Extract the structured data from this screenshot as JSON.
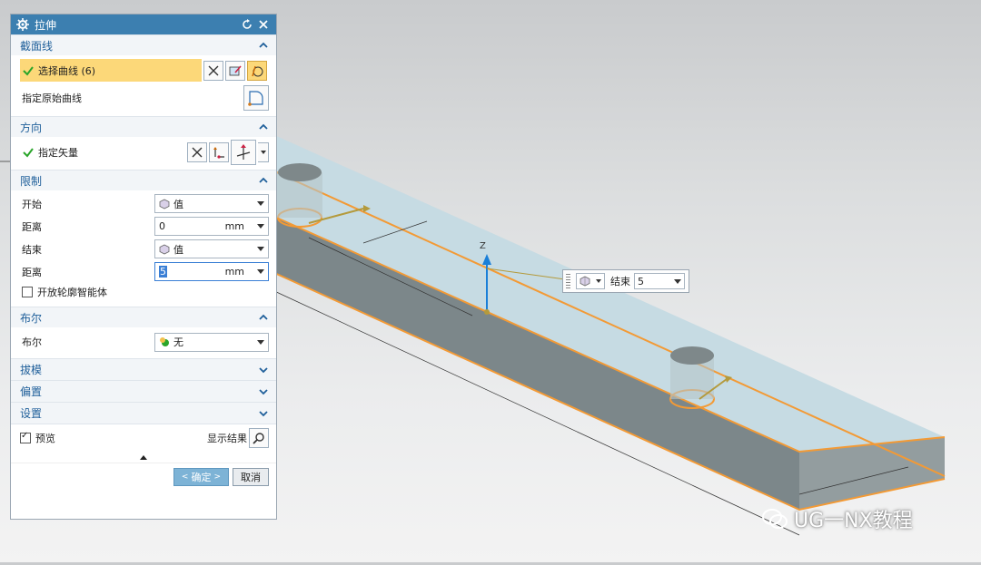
{
  "dialog": {
    "title": "拉伸",
    "section_curve": {
      "title": "截面线",
      "select_curve_label": "选择曲线 (6)",
      "origin_curve_label": "指定原始曲线"
    },
    "section_direction": {
      "title": "方向",
      "vector_label": "指定矢量"
    },
    "section_limits": {
      "title": "限制",
      "start_label": "开始",
      "start_value": "值",
      "distance1_label": "距离",
      "distance1_value": "0",
      "distance1_unit": "mm",
      "end_label": "结束",
      "end_value": "值",
      "distance2_label": "距离",
      "distance2_value": "5",
      "distance2_unit": "mm",
      "open_profile_label": "开放轮廓智能体"
    },
    "section_boolean": {
      "title": "布尔",
      "boolean_label": "布尔",
      "boolean_value": "无"
    },
    "section_draft": {
      "title": "拔模"
    },
    "section_offset": {
      "title": "偏置"
    },
    "section_settings": {
      "title": "设置"
    },
    "preview_label": "预览",
    "show_result_label": "显示结果",
    "ok_label": "确定",
    "cancel_label": "取消"
  },
  "float_widget": {
    "end_label": "结束",
    "end_value": "5"
  },
  "viewport": {
    "axis_label": "Z"
  },
  "watermark": {
    "text": "UG一NX教程"
  },
  "colors": {
    "title_bar": "#3c7fb0",
    "highlight": "#fcd879",
    "section_text": "#1f5f9a",
    "edge_orange": "#f39a35",
    "axis_blue": "#1a7fd8"
  }
}
